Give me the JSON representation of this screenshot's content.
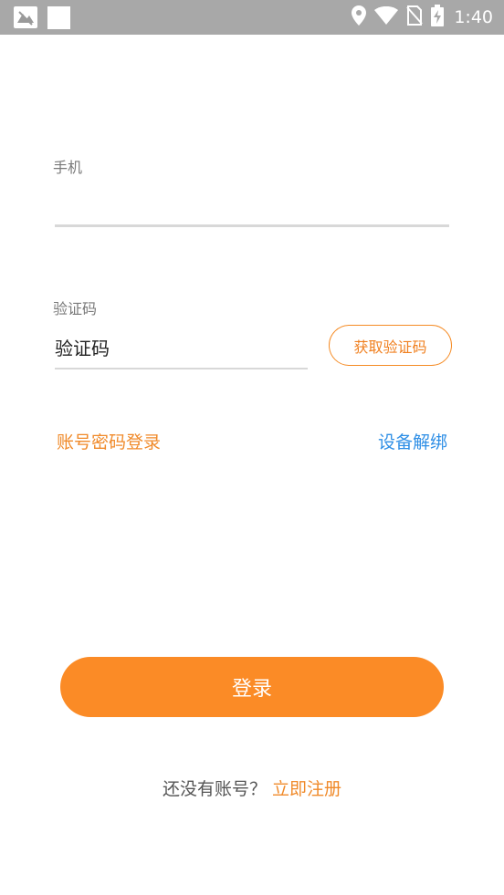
{
  "status_bar": {
    "time": "1:40",
    "icons": [
      "app-notification-icon",
      "blank-notification-icon",
      "location-icon",
      "wifi-icon",
      "no-sim-icon",
      "battery-charging-icon"
    ]
  },
  "form": {
    "phone": {
      "label": "手机",
      "value": ""
    },
    "code": {
      "label": "验证码",
      "placeholder": "验证码",
      "get_code_label": "获取验证码"
    }
  },
  "links": {
    "password_login": "账号密码登录",
    "device_unbind": "设备解绑"
  },
  "login_button": "登录",
  "register": {
    "prompt": "还没有账号？",
    "link": "立即注册"
  },
  "colors": {
    "accent": "#fb8b26",
    "link_blue": "#2f8fe6",
    "status_bar": "#a8a8a8"
  }
}
